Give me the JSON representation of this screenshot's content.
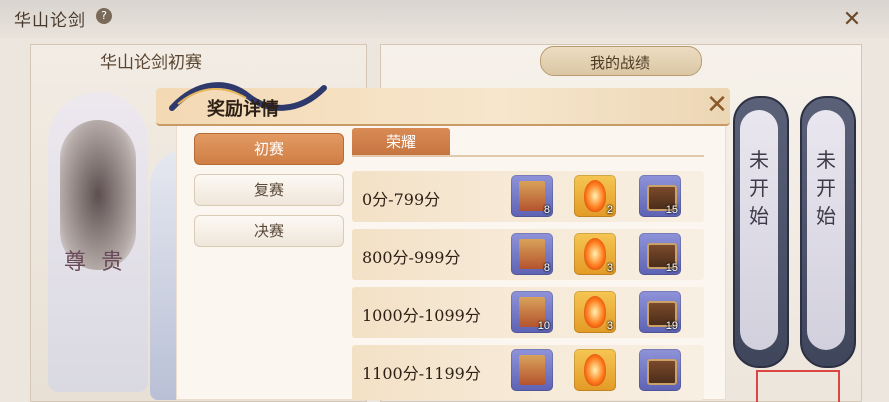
{
  "background": {
    "title": "华山论剑",
    "help_symbol": "?",
    "left_title": "华山论剑初赛",
    "medal_text": "尊 贵",
    "record_title": "我的战绩",
    "pills": [
      "未开始",
      "未开始"
    ]
  },
  "dialog": {
    "title": "奖励详情",
    "close_symbol": "✕",
    "side_tabs": [
      {
        "label": "初赛",
        "active": true
      },
      {
        "label": "复赛",
        "active": false
      },
      {
        "label": "决赛",
        "active": false
      }
    ],
    "tab": "荣耀",
    "rows": [
      {
        "label": "0分-799分",
        "items": [
          {
            "icon": "scroll-icon",
            "count": "8"
          },
          {
            "icon": "flame-token-icon",
            "count": "2"
          },
          {
            "icon": "chest-icon",
            "count": "15"
          }
        ]
      },
      {
        "label": "800分-999分",
        "items": [
          {
            "icon": "scroll-icon",
            "count": "8"
          },
          {
            "icon": "flame-token-icon",
            "count": "3"
          },
          {
            "icon": "chest-icon",
            "count": "15"
          }
        ]
      },
      {
        "label": "1000分-1099分",
        "items": [
          {
            "icon": "scroll-icon",
            "count": "10"
          },
          {
            "icon": "flame-token-icon",
            "count": "3"
          },
          {
            "icon": "chest-icon",
            "count": "19"
          }
        ]
      },
      {
        "label": "1100分-1199分",
        "items": [
          {
            "icon": "scroll-icon",
            "count": ""
          },
          {
            "icon": "flame-token-icon",
            "count": ""
          },
          {
            "icon": "chest-icon",
            "count": ""
          }
        ]
      }
    ]
  },
  "colors": {
    "accent": "#cf7e45",
    "panel": "#fbf6ef"
  }
}
